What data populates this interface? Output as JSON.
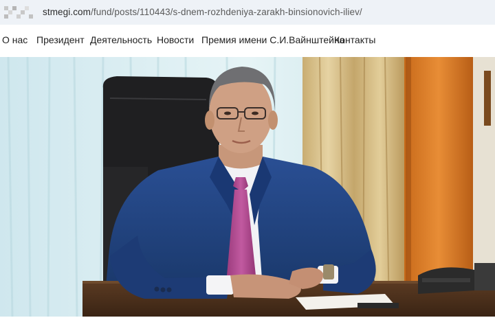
{
  "address_bar": {
    "domain": "stmegi.com",
    "path": "/fund/posts/110443/s-dnem-rozhdeniya-zarakh-binsionovich-iliev/"
  },
  "nav": {
    "items": [
      {
        "label": "О нас"
      },
      {
        "label": "Президент"
      },
      {
        "label": "Деятельность"
      },
      {
        "label": "Новости"
      },
      {
        "label": "Премия имени С.И.Вайнштейна"
      },
      {
        "label": "Контакты"
      }
    ]
  },
  "colors": {
    "jacket": "#1e3f7c",
    "tie": "#b04a8f",
    "curtain": "#d6bf8a",
    "wall_orange": "#e0832a",
    "window_light": "#d8eef2"
  }
}
